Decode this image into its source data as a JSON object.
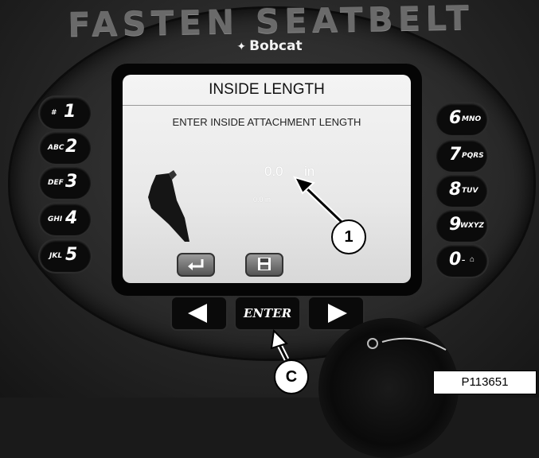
{
  "panel": {
    "header_text": "FASTEN SEATBELT",
    "brand": "Bobcat"
  },
  "screen": {
    "title": "INSIDE LENGTH",
    "prompt": "ENTER INSIDE ATTACHMENT LENGTH",
    "value": "0.0",
    "unit": "in",
    "sub_value": "0.0 in"
  },
  "keypad_left": [
    {
      "number": "1",
      "letters": "#"
    },
    {
      "number": "2",
      "letters": "ABC"
    },
    {
      "number": "3",
      "letters": "DEF"
    },
    {
      "number": "4",
      "letters": "GHI"
    },
    {
      "number": "5",
      "letters": "JKL"
    }
  ],
  "keypad_right": [
    {
      "number": "6",
      "letters": "MNO"
    },
    {
      "number": "7",
      "letters": "PQRS"
    },
    {
      "number": "8",
      "letters": "TUV"
    },
    {
      "number": "9",
      "letters": "WXYZ"
    },
    {
      "number": "0",
      "letters": "–"
    }
  ],
  "nav": {
    "enter_label": "ENTER"
  },
  "callouts": {
    "one": "1",
    "c": "C"
  },
  "figure_id": "P113651"
}
